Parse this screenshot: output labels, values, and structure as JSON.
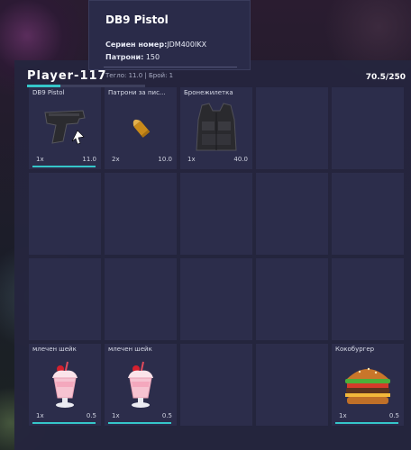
{
  "tooltip": {
    "title": "DB9 Pistol",
    "serial_label": "Сериен номер:",
    "serial_value": "JDM400IKX",
    "ammo_label": "Патрони:",
    "ammo_value": "150",
    "footer": "Тегло: 11.0 | Брой: 1"
  },
  "header": {
    "player": "Player-117",
    "weight_text": "70.5/250",
    "weight_fraction": 0.282
  },
  "slots": [
    {
      "name": "DB9 Pistol",
      "qty": "1x",
      "weight": "11.0",
      "icon": "pistol-icon",
      "bar": true
    },
    {
      "name": "Патрони за пис...",
      "qty": "2x",
      "weight": "10.0",
      "icon": "bullet-icon",
      "bar": false
    },
    {
      "name": "Бронежилетка",
      "qty": "1x",
      "weight": "40.0",
      "icon": "vest-icon",
      "bar": false
    },
    {
      "name": "",
      "qty": "",
      "weight": "",
      "icon": "",
      "bar": false
    },
    {
      "name": "",
      "qty": "",
      "weight": "",
      "icon": "",
      "bar": false
    },
    {
      "name": "",
      "qty": "",
      "weight": "",
      "icon": "",
      "bar": false
    },
    {
      "name": "",
      "qty": "",
      "weight": "",
      "icon": "",
      "bar": false
    },
    {
      "name": "",
      "qty": "",
      "weight": "",
      "icon": "",
      "bar": false
    },
    {
      "name": "",
      "qty": "",
      "weight": "",
      "icon": "",
      "bar": false
    },
    {
      "name": "",
      "qty": "",
      "weight": "",
      "icon": "",
      "bar": false
    },
    {
      "name": "",
      "qty": "",
      "weight": "",
      "icon": "",
      "bar": false
    },
    {
      "name": "",
      "qty": "",
      "weight": "",
      "icon": "",
      "bar": false
    },
    {
      "name": "",
      "qty": "",
      "weight": "",
      "icon": "",
      "bar": false
    },
    {
      "name": "",
      "qty": "",
      "weight": "",
      "icon": "",
      "bar": false
    },
    {
      "name": "",
      "qty": "",
      "weight": "",
      "icon": "",
      "bar": false
    },
    {
      "name": "млечен шейк",
      "qty": "1x",
      "weight": "0.5",
      "icon": "milkshake-icon",
      "bar": true
    },
    {
      "name": "млечен шейк",
      "qty": "1x",
      "weight": "0.5",
      "icon": "milkshake-icon",
      "bar": true
    },
    {
      "name": "",
      "qty": "",
      "weight": "",
      "icon": "",
      "bar": false
    },
    {
      "name": "",
      "qty": "",
      "weight": "",
      "icon": "",
      "bar": false
    },
    {
      "name": "Кокобургер",
      "qty": "1x",
      "weight": "0.5",
      "icon": "burger-icon",
      "bar": true
    }
  ],
  "colors": {
    "accent": "#35c6c9",
    "panel": "#25253e",
    "slot": "#2c2d4b"
  }
}
